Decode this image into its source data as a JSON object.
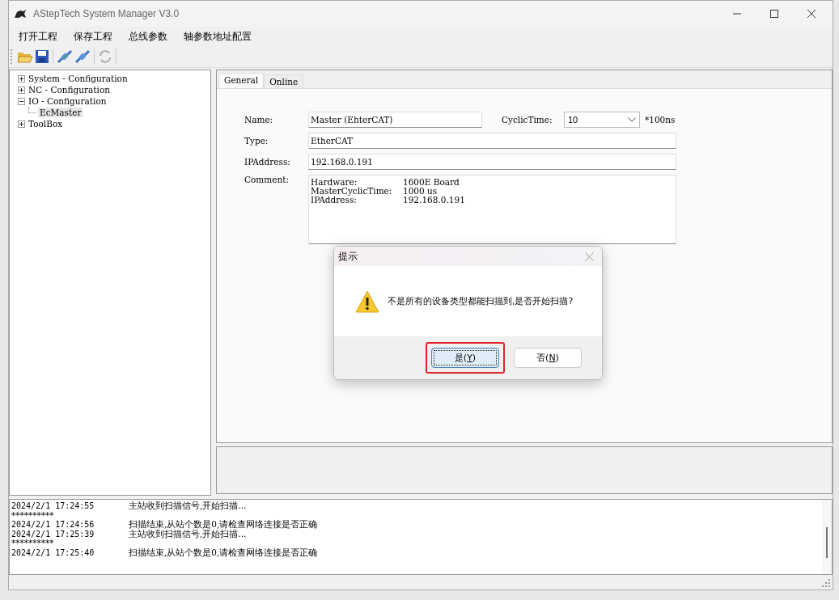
{
  "window": {
    "title": "AStepTech System Manager V3.0"
  },
  "menu": [
    "打开工程",
    "保存工程",
    "总线参数",
    "轴参数地址配置"
  ],
  "toolbar": [
    {
      "kind": "open",
      "disabled": false
    },
    {
      "kind": "save",
      "disabled": false
    },
    {
      "kind": "connect",
      "disabled": false
    },
    {
      "kind": "disconnect",
      "disabled": false
    },
    {
      "kind": "refresh",
      "disabled": true
    }
  ],
  "tree": [
    {
      "label": "System - Configuration",
      "expanded": false,
      "selected": false
    },
    {
      "label": "NC - Configuration",
      "expanded": false,
      "selected": false
    },
    {
      "label": "IO - Configuration",
      "expanded": true,
      "selected": false,
      "children": [
        {
          "label": "EcMaster",
          "selected": true
        }
      ]
    },
    {
      "label": "ToolBox",
      "expanded": false,
      "selected": false
    }
  ],
  "tabs": [
    {
      "label": "General",
      "selected": true
    },
    {
      "label": "Online",
      "selected": false
    }
  ],
  "form": {
    "name_label": "Name:",
    "name": "Master (EhterCAT)",
    "cyclic_label": "CyclicTime:",
    "cyclic": "10",
    "cyclic_unit": "*100ns",
    "type_label": "Type:",
    "type": "EtherCAT",
    "ip_label": "IPAddress:",
    "ip": "192.168.0.191",
    "comment_label": "Comment:",
    "comment": [
      [
        "Hardware:",
        "1600E Board"
      ],
      [
        "MasterCyclicTime:",
        "1000 us"
      ],
      [
        "IPAddress:",
        "192.168.0.191"
      ]
    ]
  },
  "dialog": {
    "title": "提示",
    "message": "不是所有的设备类型都能扫描到,是否开始扫描?",
    "buttons": [
      {
        "label": "是(Y)",
        "selected": true,
        "highlighted": true
      },
      {
        "label": "否(N)",
        "selected": false,
        "highlighted": false
      }
    ]
  },
  "log": [
    {
      "kind": "entry",
      "time": "2024/2/1 17:24:55",
      "message": "主站收到扫描信号,开始扫描..."
    },
    {
      "kind": "separator",
      "text": "**********"
    },
    {
      "kind": "entry",
      "time": "2024/2/1 17:24:56",
      "message": "扫描结束,从站个数是0,请检查网络连接是否正确"
    },
    {
      "kind": "entry",
      "time": "2024/2/1 17:25:39",
      "message": "主站收到扫描信号,开始扫描..."
    },
    {
      "kind": "separator",
      "text": "**********"
    },
    {
      "kind": "entry",
      "time": "2024/2/1 17:25:40",
      "message": "扫描结束,从站个数是0,请检查网络连接是否正确"
    }
  ]
}
